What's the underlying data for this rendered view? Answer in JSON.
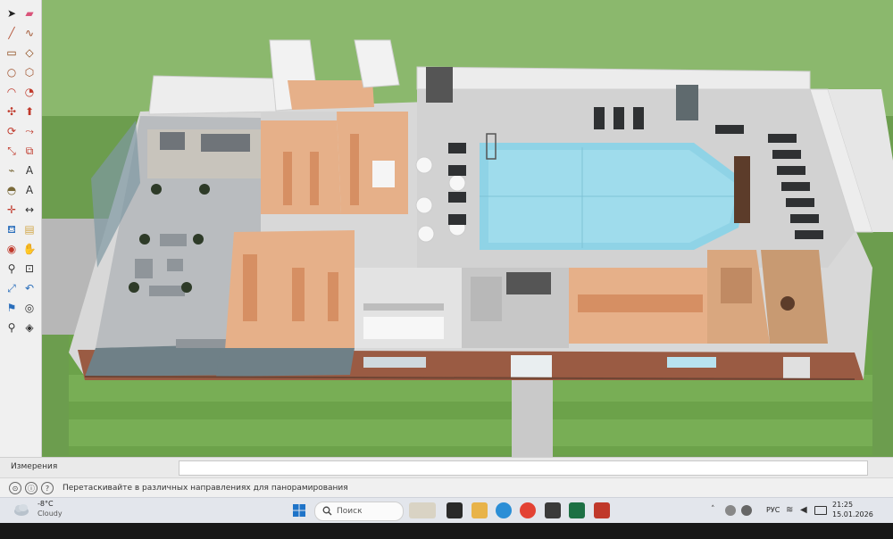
{
  "app": {
    "measurements_label": "Измерения",
    "status_hint": "Перетаскивайте в различных направлениях для панорамирования"
  },
  "toolbar": {
    "tools": [
      {
        "name": "select-tool",
        "icon": "arrow-icon",
        "color": "#222222"
      },
      {
        "name": "eraser-tool",
        "icon": "eraser-icon",
        "color": "#d9547a"
      },
      {
        "name": "line-tool",
        "icon": "pencil-icon",
        "color": "#b5553a"
      },
      {
        "name": "freehand-tool",
        "icon": "freehand-icon",
        "color": "#a0522d"
      },
      {
        "name": "rectangle-tool",
        "icon": "rectangle-icon",
        "color": "#8b4513"
      },
      {
        "name": "rotated-rectangle-tool",
        "icon": "rotated-rectangle-icon",
        "color": "#8b4513"
      },
      {
        "name": "circle-tool",
        "icon": "circle-icon",
        "color": "#a0522d"
      },
      {
        "name": "polygon-tool",
        "icon": "polygon-icon",
        "color": "#a0522d"
      },
      {
        "name": "arc-tool",
        "icon": "arc-icon",
        "color": "#c0392b"
      },
      {
        "name": "pie-tool",
        "icon": "pie-icon",
        "color": "#c0392b"
      },
      {
        "name": "move-tool",
        "icon": "move-icon",
        "color": "#c0392b"
      },
      {
        "name": "push-pull-tool",
        "icon": "push-pull-icon",
        "color": "#c0392b"
      },
      {
        "name": "rotate-tool",
        "icon": "rotate-icon",
        "color": "#c0392b"
      },
      {
        "name": "follow-me-tool",
        "icon": "follow-me-icon",
        "color": "#c0392b"
      },
      {
        "name": "scale-tool",
        "icon": "scale-icon",
        "color": "#c0392b"
      },
      {
        "name": "offset-tool",
        "icon": "offset-icon",
        "color": "#c0392b"
      },
      {
        "name": "tape-measure-tool",
        "icon": "tape-measure-icon",
        "color": "#7a6a3a"
      },
      {
        "name": "text-tool",
        "icon": "text-icon",
        "color": "#333333"
      },
      {
        "name": "protractor-tool",
        "icon": "protractor-icon",
        "color": "#7a6a3a"
      },
      {
        "name": "3d-text-tool",
        "icon": "3d-text-icon",
        "color": "#333333"
      },
      {
        "name": "axes-tool",
        "icon": "axes-icon",
        "color": "#c0392b"
      },
      {
        "name": "dimension-tool",
        "icon": "dimension-icon",
        "color": "#333333"
      },
      {
        "name": "paint-bucket-tool",
        "icon": "paint-bucket-icon",
        "color": "#2a6ebb"
      },
      {
        "name": "section-plane-tool",
        "icon": "section-plane-icon",
        "color": "#d2a84a"
      },
      {
        "name": "orbit-tool",
        "icon": "orbit-icon",
        "color": "#c0392b"
      },
      {
        "name": "pan-tool",
        "icon": "pan-icon",
        "color": "#d2a84a"
      },
      {
        "name": "zoom-tool",
        "icon": "zoom-icon",
        "color": "#333333"
      },
      {
        "name": "zoom-window-tool",
        "icon": "zoom-window-icon",
        "color": "#333333"
      },
      {
        "name": "zoom-extents-tool",
        "icon": "zoom-extents-icon",
        "color": "#2a6ebb"
      },
      {
        "name": "previous-view-tool",
        "icon": "previous-view-icon",
        "color": "#2a6ebb"
      },
      {
        "name": "position-camera-tool",
        "icon": "position-camera-icon",
        "color": "#2a6ebb"
      },
      {
        "name": "look-around-tool",
        "icon": "eye-icon",
        "color": "#333333"
      },
      {
        "name": "walk-tool",
        "icon": "walk-icon",
        "color": "#333333"
      },
      {
        "name": "section-fill-tool",
        "icon": "section-fill-icon",
        "color": "#333333"
      }
    ]
  },
  "taskbar": {
    "weather_temp": "-8°C",
    "weather_desc": "Cloudy",
    "search_placeholder": "Поиск",
    "language": "РУС",
    "time": "21:25",
    "date": "15.01.2026"
  },
  "colors": {
    "grass": "#6c9d4e",
    "pool_water": "#8fd3e6",
    "wood_floor": "#e6b089",
    "tile_floor": "#b9bcbf",
    "brick": "#9a5b43",
    "wall": "#ededed"
  }
}
